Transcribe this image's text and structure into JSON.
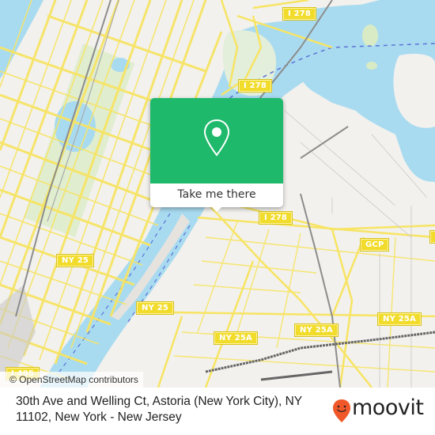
{
  "map": {
    "attribution": "© OpenStreetMap contributors",
    "colors": {
      "land": "#f2f1ed",
      "water": "#a9dbf0",
      "park": "#d9ebc4",
      "road": "#f7e463",
      "rail": "#8c8c8c",
      "shield": "#f2dc2b"
    },
    "road_shields": [
      {
        "label": "I 278",
        "id": "i278-north"
      },
      {
        "label": "I 278",
        "id": "i278-middle"
      },
      {
        "label": "I 278",
        "id": "i278-east"
      },
      {
        "label": "GCP",
        "id": "gcp-1"
      },
      {
        "label": "G",
        "id": "gcp-2"
      },
      {
        "label": "NY 25",
        "id": "ny25-west"
      },
      {
        "label": "NY 25",
        "id": "ny25-south"
      },
      {
        "label": "NY 25A",
        "id": "ny25a-1"
      },
      {
        "label": "NY 25A",
        "id": "ny25a-2"
      },
      {
        "label": "NY 25A",
        "id": "ny25a-3"
      },
      {
        "label": "I 495",
        "id": "i495"
      }
    ]
  },
  "popup": {
    "icon": "location-pin-icon",
    "button_label": "Take me there",
    "accent": "#1fb96b"
  },
  "footer": {
    "address": "30th Ave and Welling Ct, Astoria (New York City), NY 11102, New York - New Jersey",
    "brand": "moovit",
    "brand_color": "#f0582a"
  }
}
